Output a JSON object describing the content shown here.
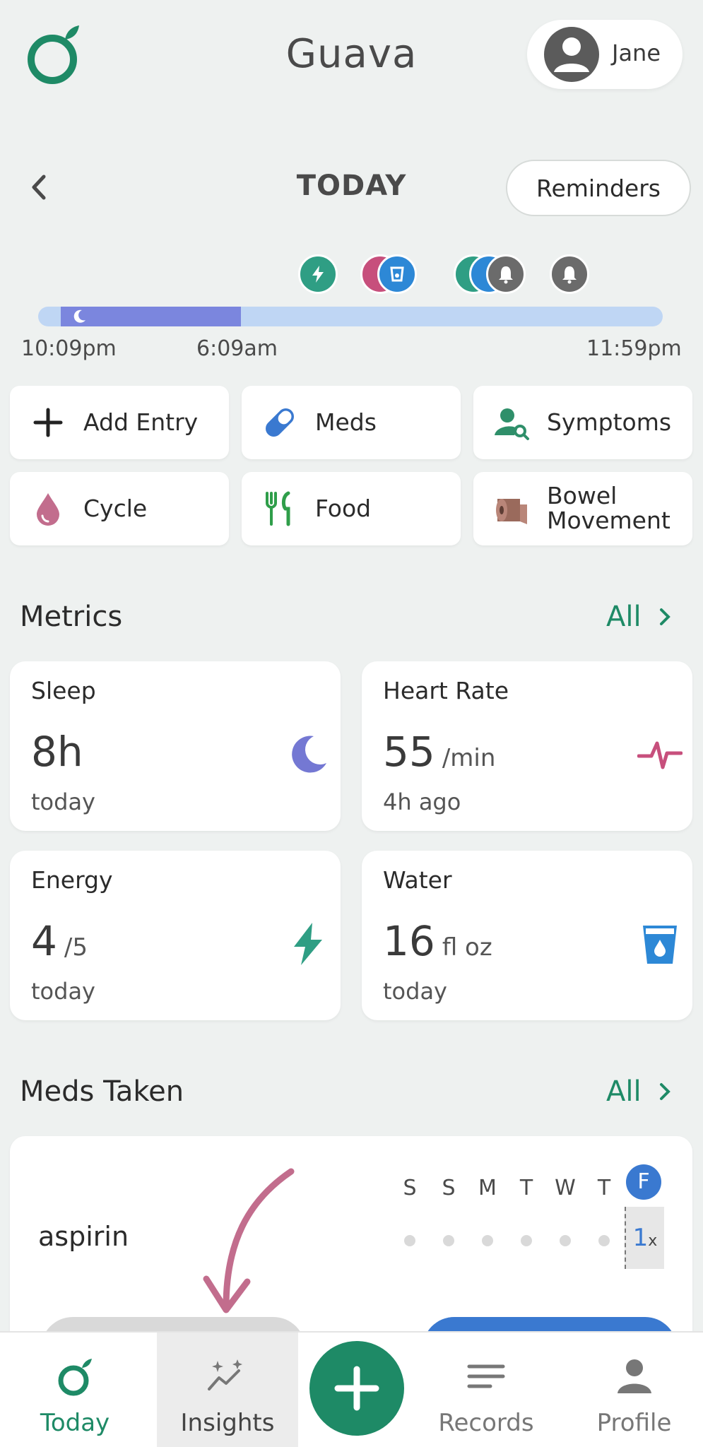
{
  "header": {
    "app_title": "Guava",
    "user_name": "Jane"
  },
  "day_nav": {
    "label": "TODAY",
    "reminders_label": "Reminders"
  },
  "timeline": {
    "times": [
      "10:09pm",
      "6:09am",
      "11:59pm"
    ]
  },
  "quick_actions": [
    {
      "label": "Add Entry",
      "icon": "plus-icon"
    },
    {
      "label": "Meds",
      "icon": "pill-icon"
    },
    {
      "label": "Symptoms",
      "icon": "person-search-icon"
    },
    {
      "label": "Cycle",
      "icon": "drop-icon"
    },
    {
      "label": "Food",
      "icon": "utensils-icon"
    },
    {
      "label": "Bowel\nMovement",
      "icon": "toilet-paper-icon"
    }
  ],
  "metrics_section": {
    "title": "Metrics",
    "all_label": "All"
  },
  "metrics": [
    {
      "title": "Sleep",
      "value": "8h",
      "unit": "",
      "time": "today",
      "icon": "moon-icon",
      "color": "#7478d3"
    },
    {
      "title": "Heart Rate",
      "value": "55",
      "unit": "/min",
      "time": "4h ago",
      "icon": "pulse-icon",
      "color": "#c74f7c"
    },
    {
      "title": "Energy",
      "value": "4",
      "unit": "/5",
      "time": "today",
      "icon": "bolt-icon",
      "color": "#2f9e84"
    },
    {
      "title": "Water",
      "value": "16",
      "unit": "fl oz",
      "time": "today",
      "icon": "water-cup-icon",
      "color": "#2d88d6"
    }
  ],
  "meds_section": {
    "title": "Meds Taken",
    "all_label": "All"
  },
  "meds": {
    "days": [
      "S",
      "S",
      "M",
      "T",
      "W",
      "T",
      "F"
    ],
    "items": [
      {
        "name": "aspirin",
        "today_count": "1",
        "today_suffix": "x"
      }
    ]
  },
  "bottom_nav": [
    {
      "label": "Today",
      "icon": "guava-icon",
      "active": true
    },
    {
      "label": "Insights",
      "icon": "insights-icon",
      "active": false
    },
    {
      "label": "Records",
      "icon": "records-icon",
      "active": false
    },
    {
      "label": "Profile",
      "icon": "profile-icon",
      "active": false
    }
  ],
  "colors": {
    "brand_green": "#1e8a66",
    "sleep_bar": "#7b86de",
    "timeline_bar": "#bfd6f4",
    "accent_pink": "#c26d8d"
  }
}
